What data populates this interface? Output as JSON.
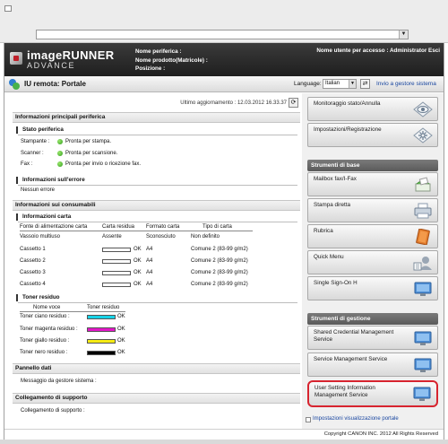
{
  "header": {
    "product_name": "imageRUNNER",
    "product_sub": "ADVANCE",
    "device_name_label": "Nome periferica :",
    "product_name_label": "Nome prodotto(Matricole) :",
    "location_label": "Posizione :",
    "user_info": "Nome utente per accesso : Administrator Esci"
  },
  "titlebar": {
    "title": "IU remota: Portale",
    "language_label": "Language:",
    "language_value": "Italian",
    "admin_link": "Invio a gestore sistema"
  },
  "main": {
    "last_update": "Ultimo aggiornamento : 12.03.2012 16.33.37",
    "sections": {
      "device_info": "Informazioni principali periferica",
      "device_status": "Stato periferica",
      "error_info": "Informazioni sull'errore",
      "consumables": "Informazioni sui consumabili",
      "paper_info": "Informazioni carta",
      "toner": "Toner residuo",
      "data_panel": "Pannello dati",
      "support_link": "Collegamento di supporto"
    },
    "status": [
      {
        "label": "Stampante :",
        "value": "Pronta per stampa."
      },
      {
        "label": "Scanner :",
        "value": "Pronta per scansione."
      },
      {
        "label": "Fax :",
        "value": "Pronta per invio o ricezione fax."
      }
    ],
    "no_error": "Nessun errore",
    "paper_headers": [
      "Fonte di alimentazione carta",
      "Carta residua",
      "Formato carta",
      "Tipo di carta"
    ],
    "paper_rows": [
      {
        "source": "Vassoio multiuso",
        "remaining": "Assente",
        "size": "Sconosciuto",
        "type": "Non definito",
        "bar": false
      },
      {
        "source": "Cassetto 1",
        "remaining": "OK",
        "size": "A4",
        "type": "Comune 2 (83-99 g/m2)",
        "bar": true
      },
      {
        "source": "Cassetto 2",
        "remaining": "OK",
        "size": "A4",
        "type": "Comune 2 (83-99 g/m2)",
        "bar": true
      },
      {
        "source": "Cassetto 3",
        "remaining": "OK",
        "size": "A4",
        "type": "Comune 2 (83-99 g/m2)",
        "bar": true
      },
      {
        "source": "Cassetto 4",
        "remaining": "OK",
        "size": "A4",
        "type": "Comune 2 (83-99 g/m2)",
        "bar": true
      }
    ],
    "toner_headers": [
      "Nome voce",
      "Toner residuo"
    ],
    "toner_rows": [
      {
        "name": "Toner ciano residuo :",
        "value": "OK",
        "color": "#17d3e6"
      },
      {
        "name": "Toner magenta residuo :",
        "value": "OK",
        "color": "#e317c8"
      },
      {
        "name": "Toner giallo residuo :",
        "value": "OK",
        "color": "#f5ea14"
      },
      {
        "name": "Toner nero residuo :",
        "value": "OK",
        "color": "#000000"
      }
    ],
    "data_panel_text": "Messaggio da gestore sistema :",
    "support_text": "Collegamento di supporto :"
  },
  "right": {
    "buttons_top": [
      {
        "label": "Monitoraggio stato/Annulla",
        "icon": "status-monitor-icon"
      },
      {
        "label": "Impostazioni/Registrazione",
        "icon": "settings-icon"
      }
    ],
    "basic_title": "Strumenti di base",
    "basic_buttons": [
      {
        "label": "Mailbox fax/I-Fax",
        "icon": "fax-mailbox-icon"
      },
      {
        "label": "Stampa diretta",
        "icon": "printer-icon"
      },
      {
        "label": "Rubrica",
        "icon": "address-book-icon"
      },
      {
        "label": "Quick Menu",
        "icon": "quick-menu-icon"
      },
      {
        "label": "Single Sign-On H",
        "icon": "monitor-icon"
      }
    ],
    "mgmt_title": "Strumenti di gestione",
    "mgmt_buttons": [
      {
        "label": "Shared Credential Management Service",
        "icon": "monitor-icon"
      },
      {
        "label": "Service Management Service",
        "icon": "monitor-icon"
      },
      {
        "label": "User Setting Information Management Service",
        "icon": "monitor-icon"
      }
    ],
    "portal_settings_link": "Impostazioni visualizzazione portale"
  },
  "footer": {
    "copyright": "Copyright CANON INC. 2012 All Rights Reserved"
  }
}
